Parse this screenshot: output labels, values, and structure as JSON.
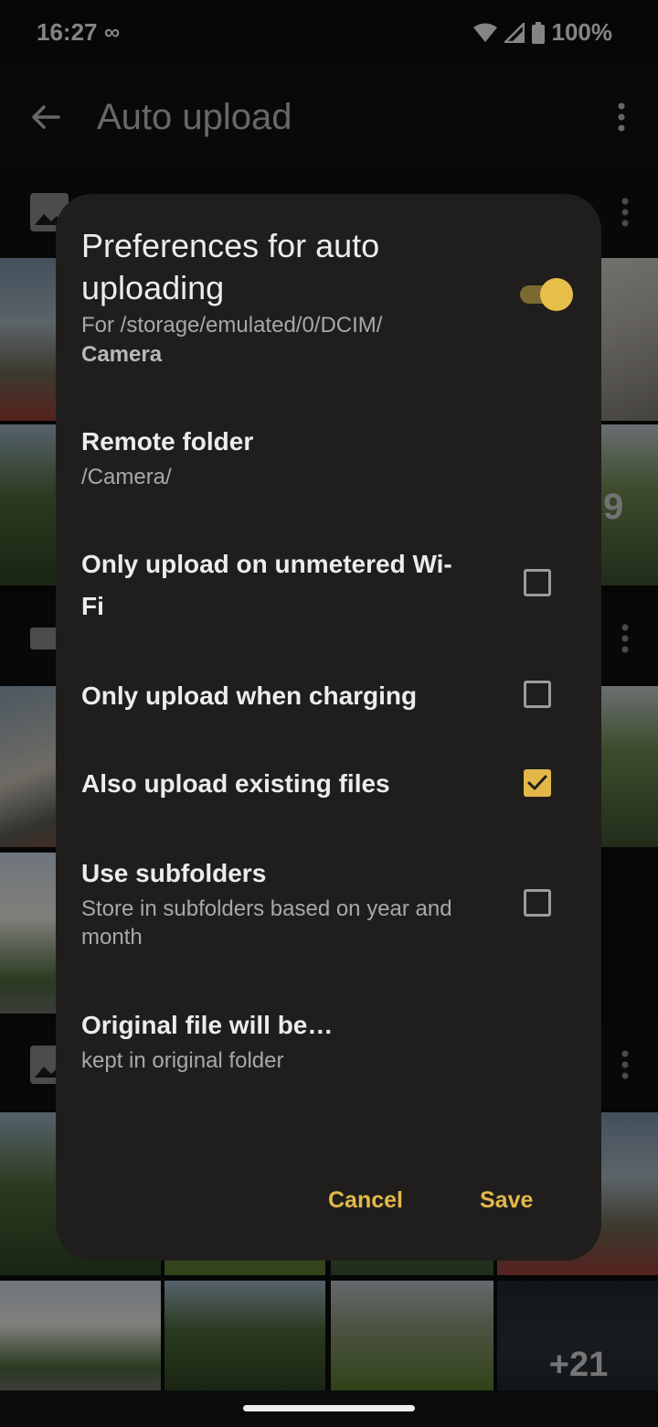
{
  "status_bar": {
    "time": "16:27",
    "infinity": "∞",
    "battery_pct": "100%"
  },
  "app_bar": {
    "title": "Auto upload"
  },
  "background": {
    "more_count": "+21",
    "partial_number": "9"
  },
  "dialog": {
    "title": "Preferences for auto uploading",
    "subtitle_prefix": "For /storage/emulated/0/DCIM/",
    "subtitle_folder": "Camera",
    "enabled": true,
    "prefs": [
      {
        "title": "Remote folder",
        "summary": "/Camera/"
      },
      {
        "title": "Only upload on unmetered Wi-Fi",
        "checked": false
      },
      {
        "title": "Only upload when charging",
        "checked": false
      },
      {
        "title": "Also upload existing files",
        "checked": true
      },
      {
        "title": "Use subfolders",
        "summary": "Store in subfolders based on year and month",
        "checked": false
      },
      {
        "title": "Original file will be…",
        "summary": "kept in original folder"
      }
    ],
    "cancel_label": "Cancel",
    "save_label": "Save"
  },
  "colors": {
    "accent": "#e3b849",
    "dialog_bg": "#1f1e1c"
  }
}
